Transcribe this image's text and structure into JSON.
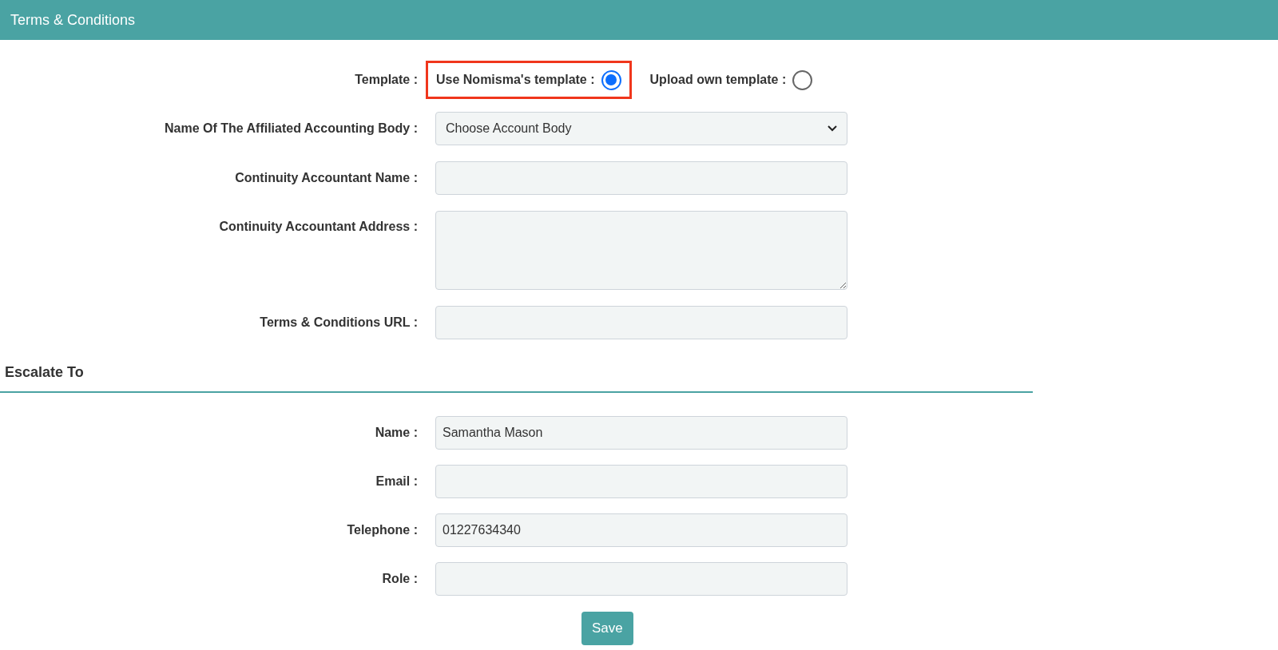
{
  "header": {
    "title": "Terms & Conditions"
  },
  "template": {
    "label": "Template :",
    "options": [
      {
        "label": "Use Nomisma's template :",
        "selected": true,
        "highlighted": true
      },
      {
        "label": "Upload own template :",
        "selected": false,
        "highlighted": false
      }
    ]
  },
  "fields": [
    {
      "kind": "select",
      "label": "Name Of The Affiliated Accounting Body :",
      "value": "Choose Account Body"
    },
    {
      "kind": "text",
      "label": "Continuity Accountant Name :"
    },
    {
      "kind": "textarea",
      "label": "Continuity Accountant Address :"
    },
    {
      "kind": "text",
      "label": "Terms & Conditions URL :"
    }
  ],
  "escalate": {
    "title": "Escalate To",
    "fields": [
      {
        "kind": "text",
        "label": "Name :",
        "value": "Samantha Mason"
      },
      {
        "kind": "text",
        "label": "Email :"
      },
      {
        "kind": "text",
        "label": "Telephone :",
        "value": "01227634340"
      },
      {
        "kind": "text",
        "label": "Role :"
      }
    ]
  },
  "save_button": "Save"
}
